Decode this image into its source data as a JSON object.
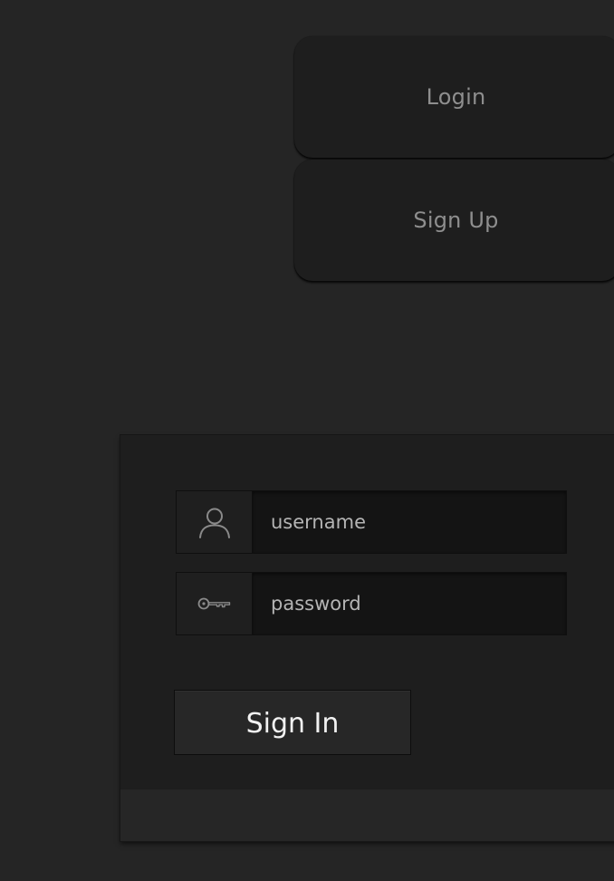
{
  "tabs": {
    "login_label": "Login",
    "signup_label": "Sign Up"
  },
  "form": {
    "username": {
      "icon": "user-icon",
      "placeholder": "username",
      "value": ""
    },
    "password": {
      "icon": "key-icon",
      "placeholder": "password",
      "value": ""
    },
    "submit_label": "Sign In"
  },
  "colors": {
    "background": "#252525",
    "panel": "#1e1e1e",
    "input": "#141414",
    "tab_text": "#8e8e8e",
    "button_text": "#f2f2f2"
  }
}
